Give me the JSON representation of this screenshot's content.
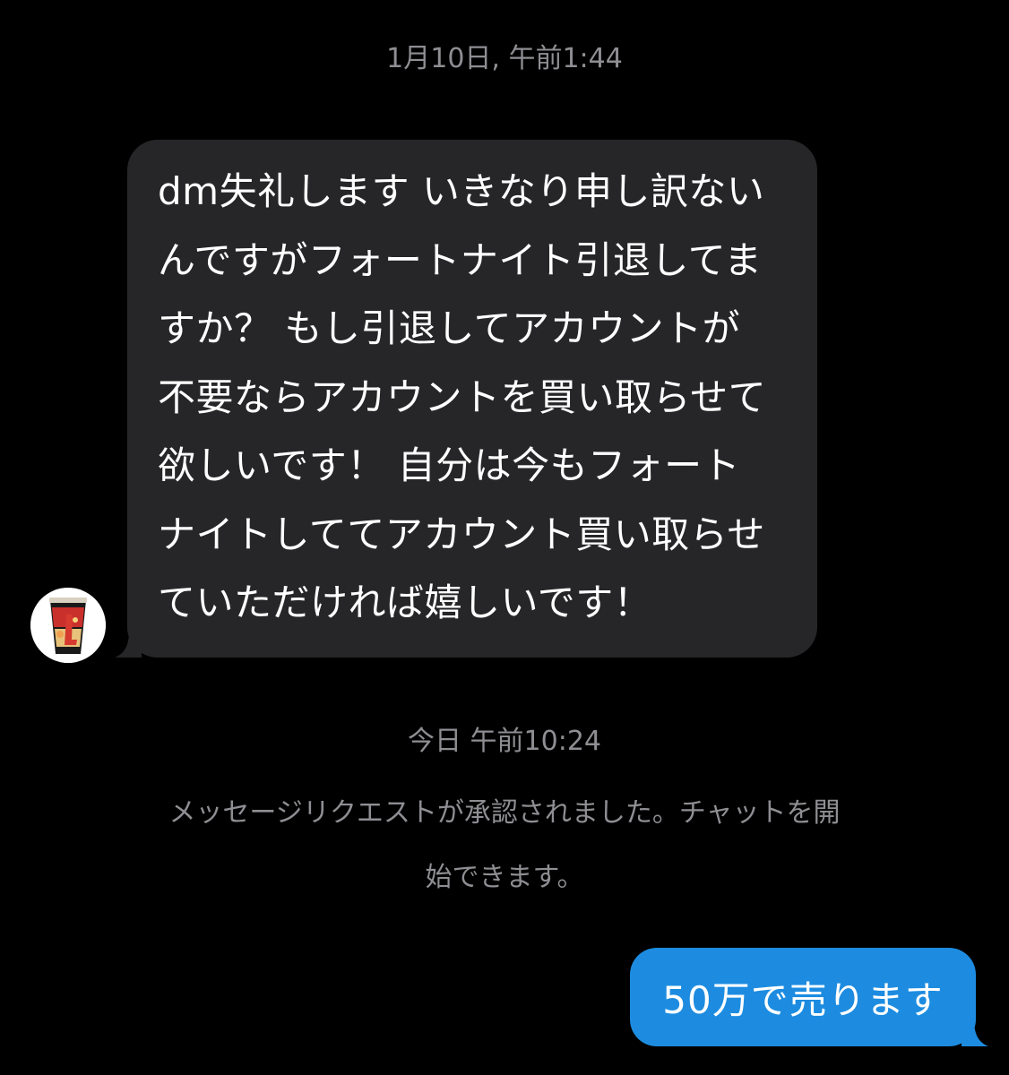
{
  "conversation": {
    "first_timestamp": "1月10日, 午前1:44",
    "incoming_message": {
      "avatar_icon": "cup-noodle-avatar",
      "text": "dm失礼します いきなり申し訳ない\nんですがフォートナイト引退してま\nすか？ もし引退してアカウントが\n不要ならアカウントを買い取らせて\n欲しいです！ 自分は今もフォート\nナイトしててアカウント買い取らせ\nていただければ嬉しいです！"
    },
    "second_timestamp": "今日 午前10:24",
    "system_message": "メッセージリクエストが承認されました。チャットを開\n始できます。",
    "outgoing_message": {
      "text": "50万で売ります"
    }
  },
  "colors": {
    "background": "#000000",
    "incoming_bubble": "#262628",
    "outgoing_bubble": "#1d8ce0",
    "secondary_text": "#8e8e93",
    "primary_text": "#ffffff"
  }
}
